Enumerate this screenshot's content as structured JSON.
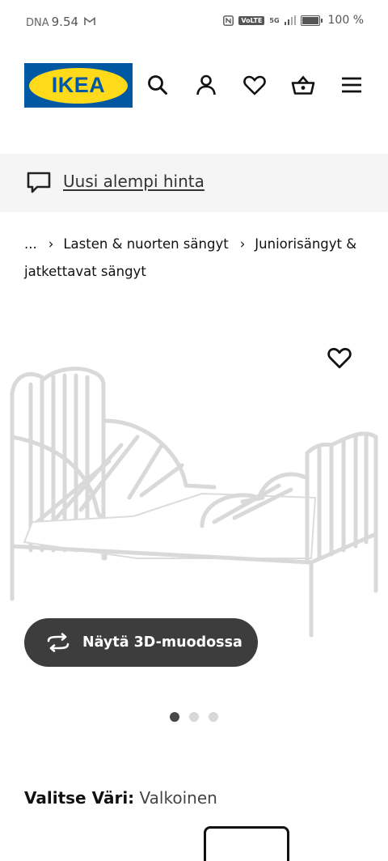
{
  "status_bar": {
    "carrier": "DNA",
    "time": "9.54",
    "mail_icon": "gmail-icon",
    "nfc_icon": "nfc-icon",
    "volte": "VoLTE",
    "network": "5G",
    "battery_text": "100 %"
  },
  "header": {
    "logo_text": "IKEA",
    "icons": [
      "search-icon",
      "account-icon",
      "heart-icon",
      "basket-icon",
      "menu-icon"
    ],
    "brand_colors": {
      "blue": "#0058a3",
      "yellow": "#ffda1a"
    }
  },
  "promo": {
    "text": "Uusi alempi hinta",
    "icon": "chat-bubble-icon"
  },
  "breadcrumb": {
    "items": [
      "...",
      "Lasten & nuorten sängyt",
      "Juniorisängyt & jatkettavat sängyt"
    ]
  },
  "gallery": {
    "button_label": "Näytä 3D-muodossa",
    "button_icon": "rotate-3d-icon",
    "image_count": 3,
    "active_index": 0
  },
  "color_selector": {
    "label": "Valitse Väri:",
    "value": "Valkoinen"
  }
}
